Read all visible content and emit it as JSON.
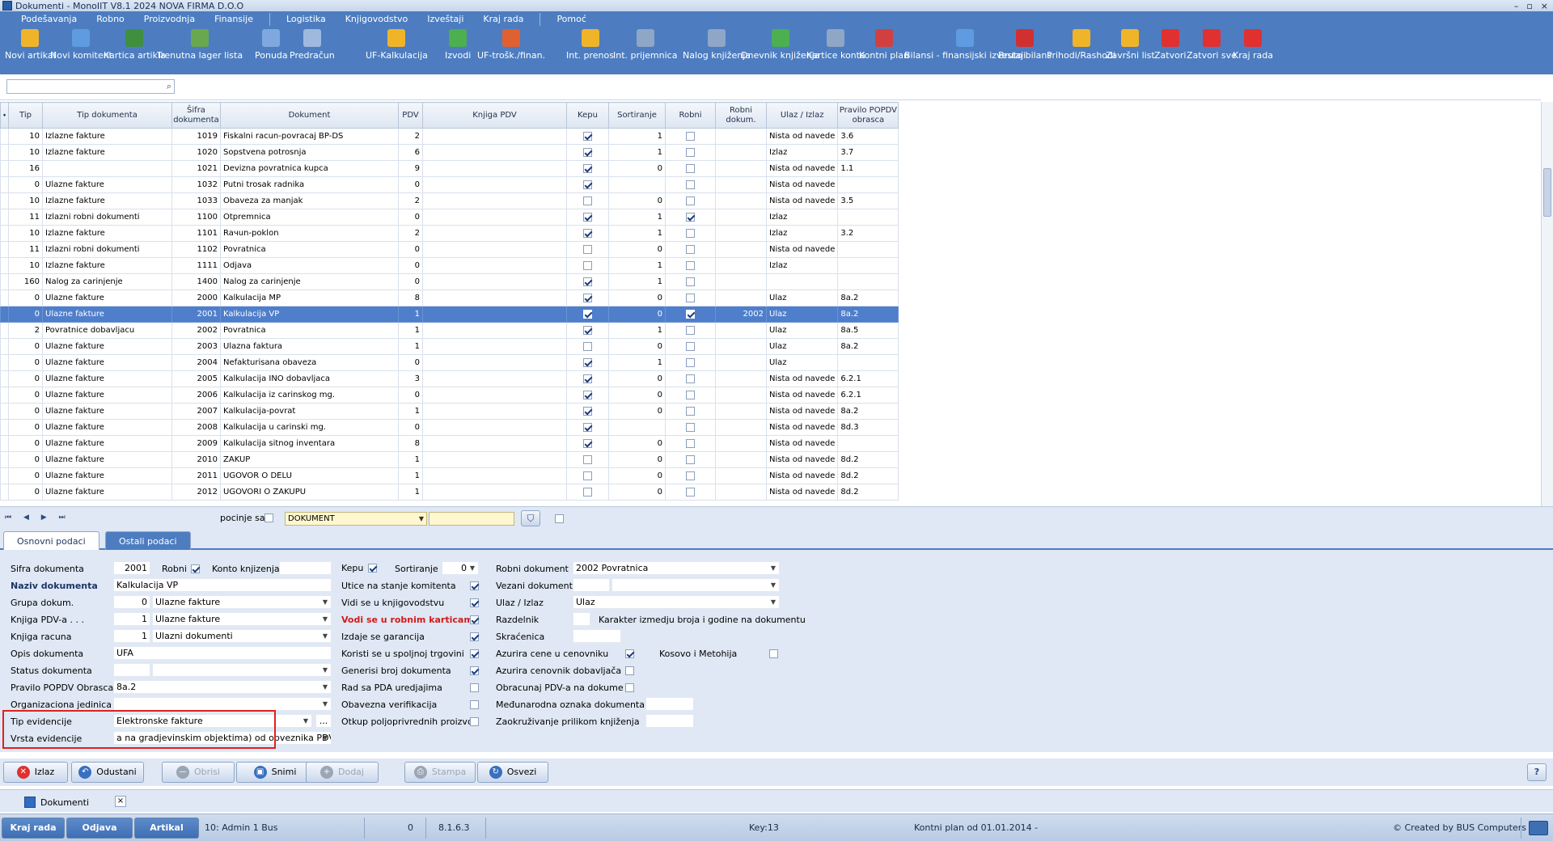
{
  "window": {
    "title": "Dokumenti - MonoIIT V8.1 2024 NOVA FIRMA D.O.O",
    "controls": [
      "–",
      "▫",
      "×"
    ]
  },
  "menu": [
    "Podešavanja",
    "Robno",
    "Proizvodnja",
    "Finansije",
    "Logistika",
    "Knjigovodstvo",
    "Izveštaji",
    "Kraj rada",
    "Pomoć"
  ],
  "toolbar": [
    {
      "label": "Novi artikal",
      "icon": "new-article-icon",
      "color": "#f0b429"
    },
    {
      "label": "Novi komitent",
      "icon": "new-client-icon",
      "color": "#5f9be0"
    },
    {
      "label": "Kartica artikla",
      "icon": "article-card-icon",
      "color": "#3f8f3f"
    },
    {
      "label": "Trenutna lager lista",
      "icon": "stock-list-icon",
      "color": "#6aa84f"
    },
    {
      "label": "Ponuda",
      "icon": "offer-icon",
      "color": "#7fa8de"
    },
    {
      "label": "Predračun",
      "icon": "proforma-icon",
      "color": "#9fb9de"
    },
    {
      "label": "UF-Kalkulacija",
      "icon": "calculation-icon",
      "color": "#f0b429"
    },
    {
      "label": "Izvodi",
      "icon": "statements-icon",
      "color": "#4caf50"
    },
    {
      "label": "UF-trošk./finan.",
      "icon": "costs-icon",
      "color": "#e06030"
    },
    {
      "label": "Int. prenos",
      "icon": "internal-transfer-icon",
      "color": "#f0b429"
    },
    {
      "label": "Int. prijemnica",
      "icon": "internal-receipt-icon",
      "color": "#8fa6c7"
    },
    {
      "label": "Nalog knjiženja",
      "icon": "posting-order-icon",
      "color": "#8fa6c7"
    },
    {
      "label": "Dnevnik knjiženja",
      "icon": "posting-journal-icon",
      "color": "#4caf50"
    },
    {
      "label": "Kartice konta",
      "icon": "account-cards-icon",
      "color": "#8fa6c7"
    },
    {
      "label": "Kontni plan",
      "icon": "chart-of-accounts-icon",
      "color": "#d04040"
    },
    {
      "label": "Bilansi - finansijski izvestaji",
      "icon": "balance-icon",
      "color": "#5f9be0"
    },
    {
      "label": "Bruto bilans",
      "icon": "gross-balance-icon",
      "color": "#d03030"
    },
    {
      "label": "Prihodi/Rashodi",
      "icon": "income-expense-icon",
      "color": "#f0b429"
    },
    {
      "label": "Završni list",
      "icon": "final-sheet-icon",
      "color": "#f0b429"
    },
    {
      "label": "Zatvori",
      "icon": "close-x-icon",
      "color": "#e03030"
    },
    {
      "label": "Zatvori sve",
      "icon": "close-all-icon",
      "color": "#e03030"
    },
    {
      "label": "Kraj rada",
      "icon": "power-icon",
      "color": "#e03030"
    }
  ],
  "search": {
    "value": ""
  },
  "grid": {
    "columns": [
      "Tip",
      "Tip dokumenta",
      "Šifra dokumenta",
      "Dokument",
      "PDV",
      "Knjiga  PDV",
      "Kepu",
      "Sortiranje",
      "Robni",
      "Robni dokum.",
      "Ulaz / Izlaz",
      "Pravilo POPDV obrasca"
    ],
    "rows": [
      {
        "tip": "10",
        "tipdok": "Izlazne fakture",
        "sifra": "1019",
        "dok": "Fiskalni racun-povracaj BP-DS",
        "pdv": "2",
        "knjiga": "",
        "kepu": true,
        "sort": "1",
        "robni": false,
        "robnidok": "",
        "ulaz": "Nista od navede",
        "pravilo": "3.6"
      },
      {
        "tip": "10",
        "tipdok": "Izlazne fakture",
        "sifra": "1020",
        "dok": "Sopstvena potrosnja",
        "pdv": "6",
        "knjiga": "",
        "kepu": true,
        "sort": "1",
        "robni": false,
        "robnidok": "",
        "ulaz": "Izlaz",
        "pravilo": "3.7"
      },
      {
        "tip": "16",
        "tipdok": "",
        "sifra": "1021",
        "dok": "Devizna povratnica kupca",
        "pdv": "9",
        "knjiga": "",
        "kepu": true,
        "sort": "0",
        "robni": false,
        "robnidok": "",
        "ulaz": "Nista od navede",
        "pravilo": "1.1"
      },
      {
        "tip": "0",
        "tipdok": "Ulazne fakture",
        "sifra": "1032",
        "dok": "Putni trosak radnika",
        "pdv": "0",
        "knjiga": "",
        "kepu": true,
        "sort": "",
        "robni": false,
        "robnidok": "",
        "ulaz": "Nista od navede",
        "pravilo": ""
      },
      {
        "tip": "10",
        "tipdok": "Izlazne fakture",
        "sifra": "1033",
        "dok": "Obaveza za manjak",
        "pdv": "2",
        "knjiga": "",
        "kepu": false,
        "sort": "0",
        "robni": false,
        "robnidok": "",
        "ulaz": "Nista od navede",
        "pravilo": "3.5"
      },
      {
        "tip": "11",
        "tipdok": "Izlazni robni dokumenti",
        "sifra": "1100",
        "dok": "Otpremnica",
        "pdv": "0",
        "knjiga": "",
        "kepu": true,
        "sort": "1",
        "robni": true,
        "robnidok": "",
        "ulaz": "Izlaz",
        "pravilo": ""
      },
      {
        "tip": "10",
        "tipdok": "Izlazne fakture",
        "sifra": "1101",
        "dok": "Raчun-poklon",
        "pdv": "2",
        "knjiga": "",
        "kepu": true,
        "sort": "1",
        "robni": false,
        "robnidok": "",
        "ulaz": "Izlaz",
        "pravilo": "3.2"
      },
      {
        "tip": "11",
        "tipdok": "Izlazni robni dokumenti",
        "sifra": "1102",
        "dok": "Povratnica",
        "pdv": "0",
        "knjiga": "",
        "kepu": false,
        "sort": "0",
        "robni": false,
        "robnidok": "",
        "ulaz": "Nista od navede",
        "pravilo": ""
      },
      {
        "tip": "10",
        "tipdok": "Izlazne fakture",
        "sifra": "1111",
        "dok": "Odjava",
        "pdv": "0",
        "knjiga": "",
        "kepu": false,
        "sort": "1",
        "robni": false,
        "robnidok": "",
        "ulaz": "Izlaz",
        "pravilo": ""
      },
      {
        "tip": "160",
        "tipdok": "Nalog za carinjenje",
        "sifra": "1400",
        "dok": "Nalog za carinjenje",
        "pdv": "0",
        "knjiga": "",
        "kepu": true,
        "sort": "1",
        "robni": false,
        "robnidok": "",
        "ulaz": "",
        "pravilo": ""
      },
      {
        "tip": "0",
        "tipdok": "Ulazne fakture",
        "sifra": "2000",
        "dok": "Kalkulacija MP",
        "pdv": "8",
        "knjiga": "",
        "kepu": true,
        "sort": "0",
        "robni": false,
        "robnidok": "",
        "ulaz": "Ulaz",
        "pravilo": "8a.2"
      },
      {
        "tip": "0",
        "tipdok": "Ulazne fakture",
        "sifra": "2001",
        "dok": "Kalkulacija VP",
        "pdv": "1",
        "knjiga": "",
        "kepu": true,
        "sort": "0",
        "robni": true,
        "robnidok": "2002",
        "ulaz": "Ulaz",
        "pravilo": "8a.2",
        "selected": true
      },
      {
        "tip": "2",
        "tipdok": "Povratnice dobavljacu",
        "sifra": "2002",
        "dok": "Povratnica",
        "pdv": "1",
        "knjiga": "",
        "kepu": true,
        "sort": "1",
        "robni": false,
        "robnidok": "",
        "ulaz": "Ulaz",
        "pravilo": "8a.5"
      },
      {
        "tip": "0",
        "tipdok": "Ulazne fakture",
        "sifra": "2003",
        "dok": "Ulazna faktura",
        "pdv": "1",
        "knjiga": "",
        "kepu": false,
        "sort": "0",
        "robni": false,
        "robnidok": "",
        "ulaz": "Ulaz",
        "pravilo": "8a.2"
      },
      {
        "tip": "0",
        "tipdok": "Ulazne fakture",
        "sifra": "2004",
        "dok": "Nefakturisana obaveza",
        "pdv": "0",
        "knjiga": "",
        "kepu": true,
        "sort": "1",
        "robni": false,
        "robnidok": "",
        "ulaz": "Ulaz",
        "pravilo": ""
      },
      {
        "tip": "0",
        "tipdok": "Ulazne fakture",
        "sifra": "2005",
        "dok": "Kalkulacija INO dobavljaca",
        "pdv": "3",
        "knjiga": "",
        "kepu": true,
        "sort": "0",
        "robni": false,
        "robnidok": "",
        "ulaz": "Nista od navede",
        "pravilo": "6.2.1"
      },
      {
        "tip": "0",
        "tipdok": "Ulazne fakture",
        "sifra": "2006",
        "dok": "Kalkulacija iz carinskog mg.",
        "pdv": "0",
        "knjiga": "",
        "kepu": true,
        "sort": "0",
        "robni": false,
        "robnidok": "",
        "ulaz": "Nista od navede",
        "pravilo": "6.2.1"
      },
      {
        "tip": "0",
        "tipdok": "Ulazne fakture",
        "sifra": "2007",
        "dok": "Kalkulacija-povrat",
        "pdv": "1",
        "knjiga": "",
        "kepu": true,
        "sort": "0",
        "robni": false,
        "robnidok": "",
        "ulaz": "Nista od navede",
        "pravilo": "8a.2"
      },
      {
        "tip": "0",
        "tipdok": "Ulazne fakture",
        "sifra": "2008",
        "dok": "Kalkulacija u carinski mg.",
        "pdv": "0",
        "knjiga": "",
        "kepu": true,
        "sort": "",
        "robni": false,
        "robnidok": "",
        "ulaz": "Nista od navede",
        "pravilo": "8d.3"
      },
      {
        "tip": "0",
        "tipdok": "Ulazne fakture",
        "sifra": "2009",
        "dok": "Kalkulacija sitnog inventara",
        "pdv": "8",
        "knjiga": "",
        "kepu": true,
        "sort": "0",
        "robni": false,
        "robnidok": "",
        "ulaz": "Nista od navede",
        "pravilo": ""
      },
      {
        "tip": "0",
        "tipdok": "Ulazne fakture",
        "sifra": "2010",
        "dok": "ZAKUP",
        "pdv": "1",
        "knjiga": "",
        "kepu": false,
        "sort": "0",
        "robni": false,
        "robnidok": "",
        "ulaz": "Nista od navede",
        "pravilo": "8d.2"
      },
      {
        "tip": "0",
        "tipdok": "Ulazne fakture",
        "sifra": "2011",
        "dok": "UGOVOR O DELU",
        "pdv": "1",
        "knjiga": "",
        "kepu": false,
        "sort": "0",
        "robni": false,
        "robnidok": "",
        "ulaz": "Nista od navede",
        "pravilo": "8d.2"
      },
      {
        "tip": "0",
        "tipdok": "Ulazne fakture",
        "sifra": "2012",
        "dok": "UGOVORI O ZAKUPU",
        "pdv": "1",
        "knjiga": "",
        "kepu": false,
        "sort": "0",
        "robni": false,
        "robnidok": "",
        "ulaz": "Nista od navede",
        "pravilo": "8d.2"
      }
    ]
  },
  "navbar": {
    "buttons": "⏮ ◀ ▶ ⏭",
    "pocinje_label": "pocinje sa",
    "filter_field": "DOKUMENT",
    "filter_value": ""
  },
  "tabs": {
    "active": "Osnovni podaci",
    "other": "Ostali podaci"
  },
  "form": {
    "sifra_label": "Sifra dokumenta",
    "sifra": "2001",
    "robni_label": "Robni",
    "robni": true,
    "konto_label": "Konto knjizenja",
    "konto": "",
    "naziv_label": "Naziv dokumenta",
    "naziv": "Kalkulacija VP",
    "grupa_label": "Grupa dokum.",
    "grupa_code": "0",
    "grupa": "Ulazne fakture",
    "knjigapdv_label": "Knjiga PDV-a . . .",
    "knjigapdv_code": "1",
    "knjigapdv": "Ulazne fakture",
    "knjigarac_label": "Knjiga racuna",
    "knjigarac_code": "1",
    "knjigarac": "Ulazni dokumenti",
    "opis_label": "Opis dokumenta",
    "opis": "UFA",
    "status_label": "Status dokumenta",
    "status": "",
    "pravilo_label": "Pravilo POPDV Obrasca",
    "pravilo": "8a.2",
    "org_label": "Organizaciona jedinica",
    "org": "",
    "tipev_label": "Tip evidencije",
    "tipev": "Elektronske fakture",
    "tipev_btn": "...",
    "vrstaev_label": "Vrsta evidencije",
    "vrstaev": "a na gradjevinskim objektima) od obveznika PDV",
    "kepu_label": "Kepu",
    "kepu": true,
    "sort_label": "Sortiranje",
    "sort": "0",
    "utice_label": "Utice na stanje komitenta",
    "utice": true,
    "vidi_label": "Vidi se u knjigovodstvu",
    "vidi": true,
    "vodi_label": "Vodi se u robnim karticama",
    "vodi": true,
    "izdaje_label": "Izdaje se garancija",
    "izdaje": true,
    "koristi_label": "Koristi se u spoljnoj trgovini",
    "koristi": true,
    "generisi_label": "Generisi broj dokumenta",
    "generisi": true,
    "pda_label": "Rad sa PDA uredjajima",
    "pda": false,
    "obavezna_label": "Obavezna verifikacija",
    "obavezna": false,
    "otkup_label": "Otkup poljoprivrednih proizvo",
    "otkup": false,
    "robnidok_label": "Robni dokument",
    "robnidok": "2002 Povratnica",
    "vezani_label": "Vezani dokument",
    "vezani": "",
    "ulaz_label": "Ulaz / Izlaz",
    "ulaz": "Ulaz",
    "razdelnik_label": "Razdelnik",
    "razdelnik": "",
    "karakter_label": "Karakter izmedju broja i godine na dokumentu",
    "skracenica_label": "Skraćenica",
    "skracenica": "",
    "azurira_label": "Azurira cene u cenovniku",
    "azurira": true,
    "kosovo_label": "Kosovo i Metohija",
    "kosovo": false,
    "azuriradob_label": "Azurira cenovnik dobavljača",
    "azuriradob": false,
    "obracun_label": "Obracunaj PDV-a na dokume",
    "obracun": false,
    "medj_label": "Međunarodna oznaka dokumenta",
    "medj": "",
    "zaokr_label": "Zaokruživanje prilikom knjiženja",
    "zaokr": ""
  },
  "buttons": [
    {
      "label": "Izlaz",
      "icon": "exit-icon",
      "color": "#e03030",
      "enabled": true
    },
    {
      "label": "Odustani",
      "icon": "undo-icon",
      "color": "#3a6fc0",
      "enabled": true
    },
    {
      "label": "Obrisi",
      "icon": "delete-icon",
      "color": "#9aa6b6",
      "enabled": false
    },
    {
      "label": "Snimi",
      "icon": "save-icon",
      "color": "#3a6fc0",
      "enabled": true
    },
    {
      "label": "Dodaj",
      "icon": "add-icon",
      "color": "#9aa6b6",
      "enabled": false
    },
    {
      "label": "Stampa",
      "icon": "print-icon",
      "color": "#9aa6b6",
      "enabled": false
    },
    {
      "label": "Osvezi",
      "icon": "refresh-icon",
      "color": "#3a6fc0",
      "enabled": true
    }
  ],
  "help": "?",
  "doctab": {
    "label": "Dokumenti",
    "close": "×"
  },
  "status": {
    "kraj": "Kraj rada",
    "odjava": "Odjava",
    "artikal": "Artikal",
    "user": "10: Admin 1 Bus",
    "zero": "0",
    "version": "8.1.6.3",
    "key": "Key:13",
    "plan": "Kontni plan od 01.01.2014 -",
    "credit": "© Created by BUS Computers"
  }
}
